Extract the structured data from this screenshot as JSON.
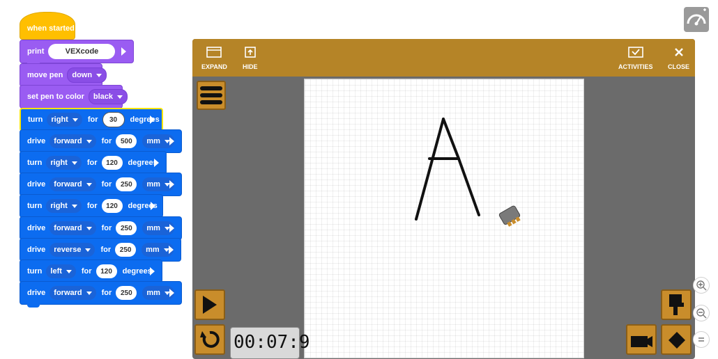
{
  "blocks": {
    "hat_label": "when started",
    "print": {
      "keyword": "print",
      "text": "VEXcode"
    },
    "move_pen": {
      "keyword": "move pen",
      "state": "down"
    },
    "set_pen_color": {
      "keyword": "set pen to color",
      "color": "black"
    },
    "commands": [
      {
        "verb": "turn",
        "dir": "right",
        "for": "for",
        "value": "30",
        "unit": "degrees"
      },
      {
        "verb": "drive",
        "dir": "forward",
        "for": "for",
        "value": "500",
        "unit": "mm"
      },
      {
        "verb": "turn",
        "dir": "right",
        "for": "for",
        "value": "120",
        "unit": "degrees"
      },
      {
        "verb": "drive",
        "dir": "forward",
        "for": "for",
        "value": "250",
        "unit": "mm"
      },
      {
        "verb": "turn",
        "dir": "right",
        "for": "for",
        "value": "120",
        "unit": "degrees"
      },
      {
        "verb": "drive",
        "dir": "forward",
        "for": "for",
        "value": "250",
        "unit": "mm"
      },
      {
        "verb": "drive",
        "dir": "reverse",
        "for": "for",
        "value": "250",
        "unit": "mm"
      },
      {
        "verb": "turn",
        "dir": "left",
        "for": "for",
        "value": "120",
        "unit": "degrees"
      },
      {
        "verb": "drive",
        "dir": "forward",
        "for": "for",
        "value": "250",
        "unit": "mm"
      }
    ]
  },
  "simulator": {
    "expand_label": "EXPAND",
    "hide_label": "HIDE",
    "activities_label": "ACTIVITIES",
    "close_label": "CLOSE",
    "timer": "00:07:9"
  },
  "colors": {
    "hat": "#FFBF00",
    "purple_block": "#9A5CF2",
    "blue_block": "#0c6cf0",
    "toolbar": "#b58427",
    "panel_bg": "#6b6b6b"
  }
}
